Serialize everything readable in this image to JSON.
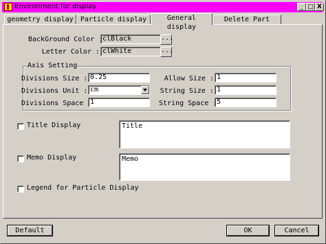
{
  "window": {
    "title": "Environment for display",
    "minimize_glyph": "_",
    "maximize_glyph": "□",
    "close_glyph": "X"
  },
  "tabs": [
    {
      "label": "geometry display",
      "active": false
    },
    {
      "label": "Particle display",
      "active": false
    },
    {
      "label": "General display",
      "active": true
    },
    {
      "label": "Delete Part",
      "active": false
    }
  ],
  "colors_section": {
    "background_label": "BackGround Color :",
    "background_value": "clBlack",
    "letter_label": "Letter Color :",
    "letter_value": "clWhite",
    "browse_label": "..."
  },
  "axis_setting": {
    "title": "Axis Setting",
    "divisions_size_label": "Divisions Size :",
    "divisions_size_value": "0.25",
    "divisions_unit_label": "Divisions Unit :",
    "divisions_unit_value": "cm",
    "divisions_space_label": "Divisions Space :",
    "divisions_space_value": "1",
    "allow_size_label": "Allow Size :",
    "allow_size_value": "1",
    "string_size_label": "String Size :",
    "string_size_value": "1",
    "string_space_label": "String Space :",
    "string_space_value": "5"
  },
  "options": {
    "title_display_label": "Title Display",
    "title_display_checked": false,
    "title_text": "Title",
    "memo_display_label": "Memo Display",
    "memo_display_checked": false,
    "memo_text": "Memo",
    "legend_label": "Legend for Particle Display",
    "legend_checked": false
  },
  "buttons": {
    "default": "Default",
    "ok": "OK",
    "cancel": "Cancel"
  },
  "colors": {
    "titlebar": "#ff00ff",
    "face": "#d4d0c8"
  }
}
